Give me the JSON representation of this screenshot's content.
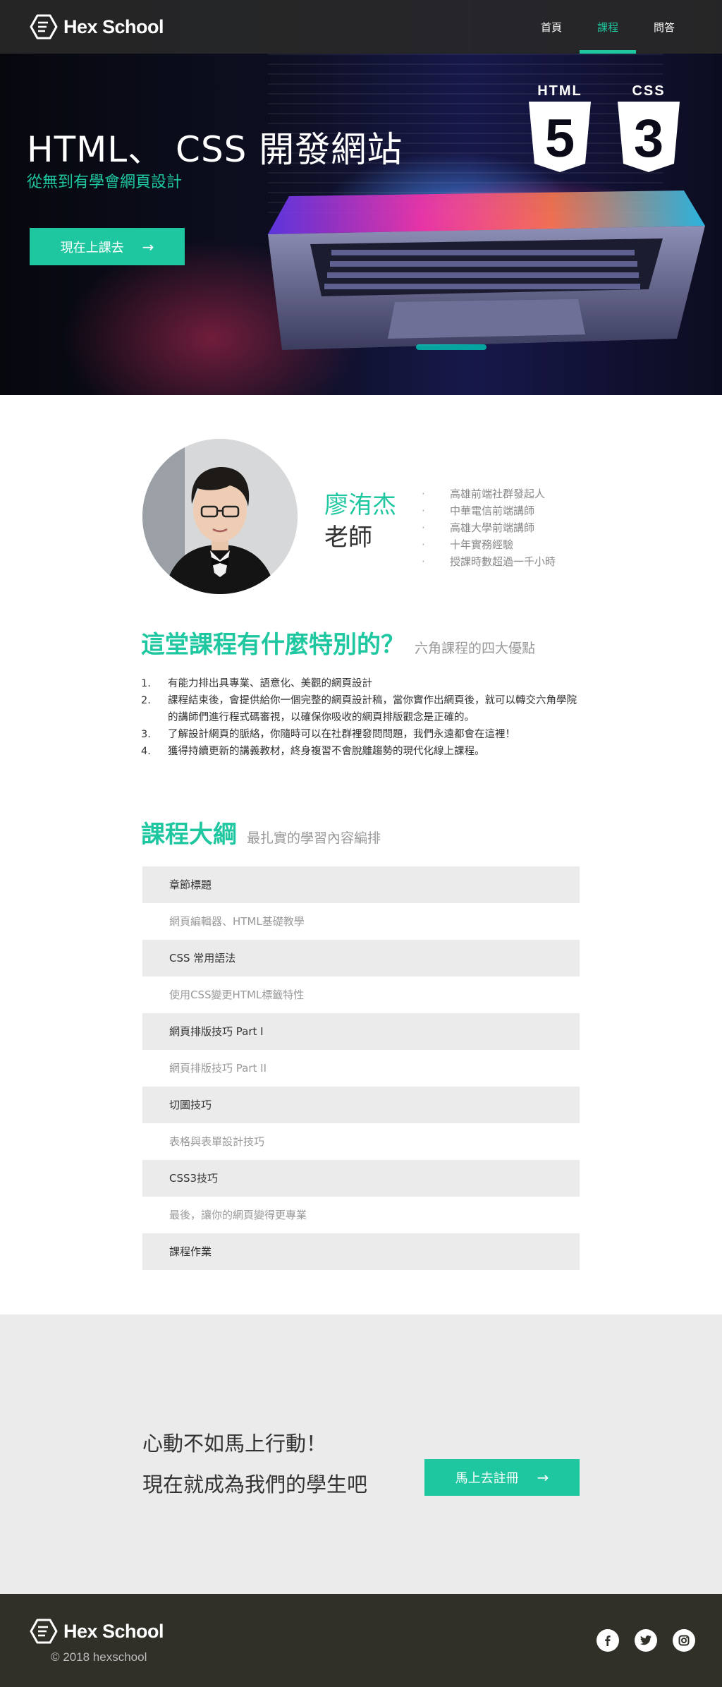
{
  "header": {
    "brand": "Hex School",
    "nav": [
      {
        "label": "首頁"
      },
      {
        "label": "課程",
        "active": true
      },
      {
        "label": "問答"
      }
    ]
  },
  "hero": {
    "title": "HTML、 CSS 開發網站",
    "subtitle": "從無到有學會網頁設計",
    "button_label": "現在上課去",
    "badge_html": "HTML",
    "badge_html_number": "5",
    "badge_css": "CSS",
    "badge_css_number": "3"
  },
  "teacher": {
    "name": "廖洧杰",
    "role": "老師",
    "facts": [
      "高雄前端社群發起人",
      "中華電信前端講師",
      "高雄大學前端講師",
      "十年實務經驗",
      "授課時數超過一千小時"
    ],
    "bullet": "·"
  },
  "features": {
    "heading": "這堂課程有什麼特別的？",
    "subheading": "六角課程的四大優點",
    "items": [
      {
        "num": "1.",
        "text": "有能力排出具專業、語意化、美觀的網頁設計"
      },
      {
        "num": "2.",
        "text": "課程結束後，會提供給你一個完整的網頁設計稿，當你實作出網頁後，就可以轉交六角學院的講師們進行程式碼審視，以確保你吸收的網頁排版觀念是正確的。"
      },
      {
        "num": "3.",
        "text": "了解設計網頁的脈絡，你隨時可以在社群裡發問問題，我們永遠都會在這裡！"
      },
      {
        "num": "4.",
        "text": "獲得持續更新的講義教材，終身複習不會脫離趨勢的現代化線上課程。"
      }
    ]
  },
  "syllabus": {
    "heading": "課程大綱",
    "subheading": "最扎實的學習內容編排",
    "rows": [
      {
        "type": "head",
        "label": "章節標題"
      },
      {
        "type": "sub",
        "label": "網頁編輯器、HTML基礎教學"
      },
      {
        "type": "head",
        "label": "CSS 常用語法"
      },
      {
        "type": "sub",
        "label": "使用CSS變更HTML標籤特性"
      },
      {
        "type": "head",
        "label": "網頁排版技巧 Part I"
      },
      {
        "type": "sub",
        "label": "網頁排版技巧 Part II"
      },
      {
        "type": "head",
        "label": "切圖技巧"
      },
      {
        "type": "sub",
        "label": "表格與表單設計技巧"
      },
      {
        "type": "head",
        "label": "CSS3技巧"
      },
      {
        "type": "sub",
        "label": "最後，讓你的網頁變得更專業"
      },
      {
        "type": "head",
        "label": "課程作業"
      }
    ]
  },
  "cta": {
    "line1": "心動不如馬上行動！",
    "line2": "現在就成為我們的學生吧",
    "button_label": "馬上去註冊"
  },
  "footer": {
    "brand": "Hex School",
    "copyright": "© 2018 hexschool",
    "socials": [
      {
        "icon": "facebook-icon",
        "glyph": "f"
      },
      {
        "icon": "twitter-icon",
        "glyph": "t"
      },
      {
        "icon": "instagram-icon",
        "glyph": "◎"
      }
    ]
  },
  "colors": {
    "accent": "#1ec79f",
    "header_bg": "#282828",
    "footer_bg": "#302f28",
    "cta_bg": "#ebebeb"
  }
}
